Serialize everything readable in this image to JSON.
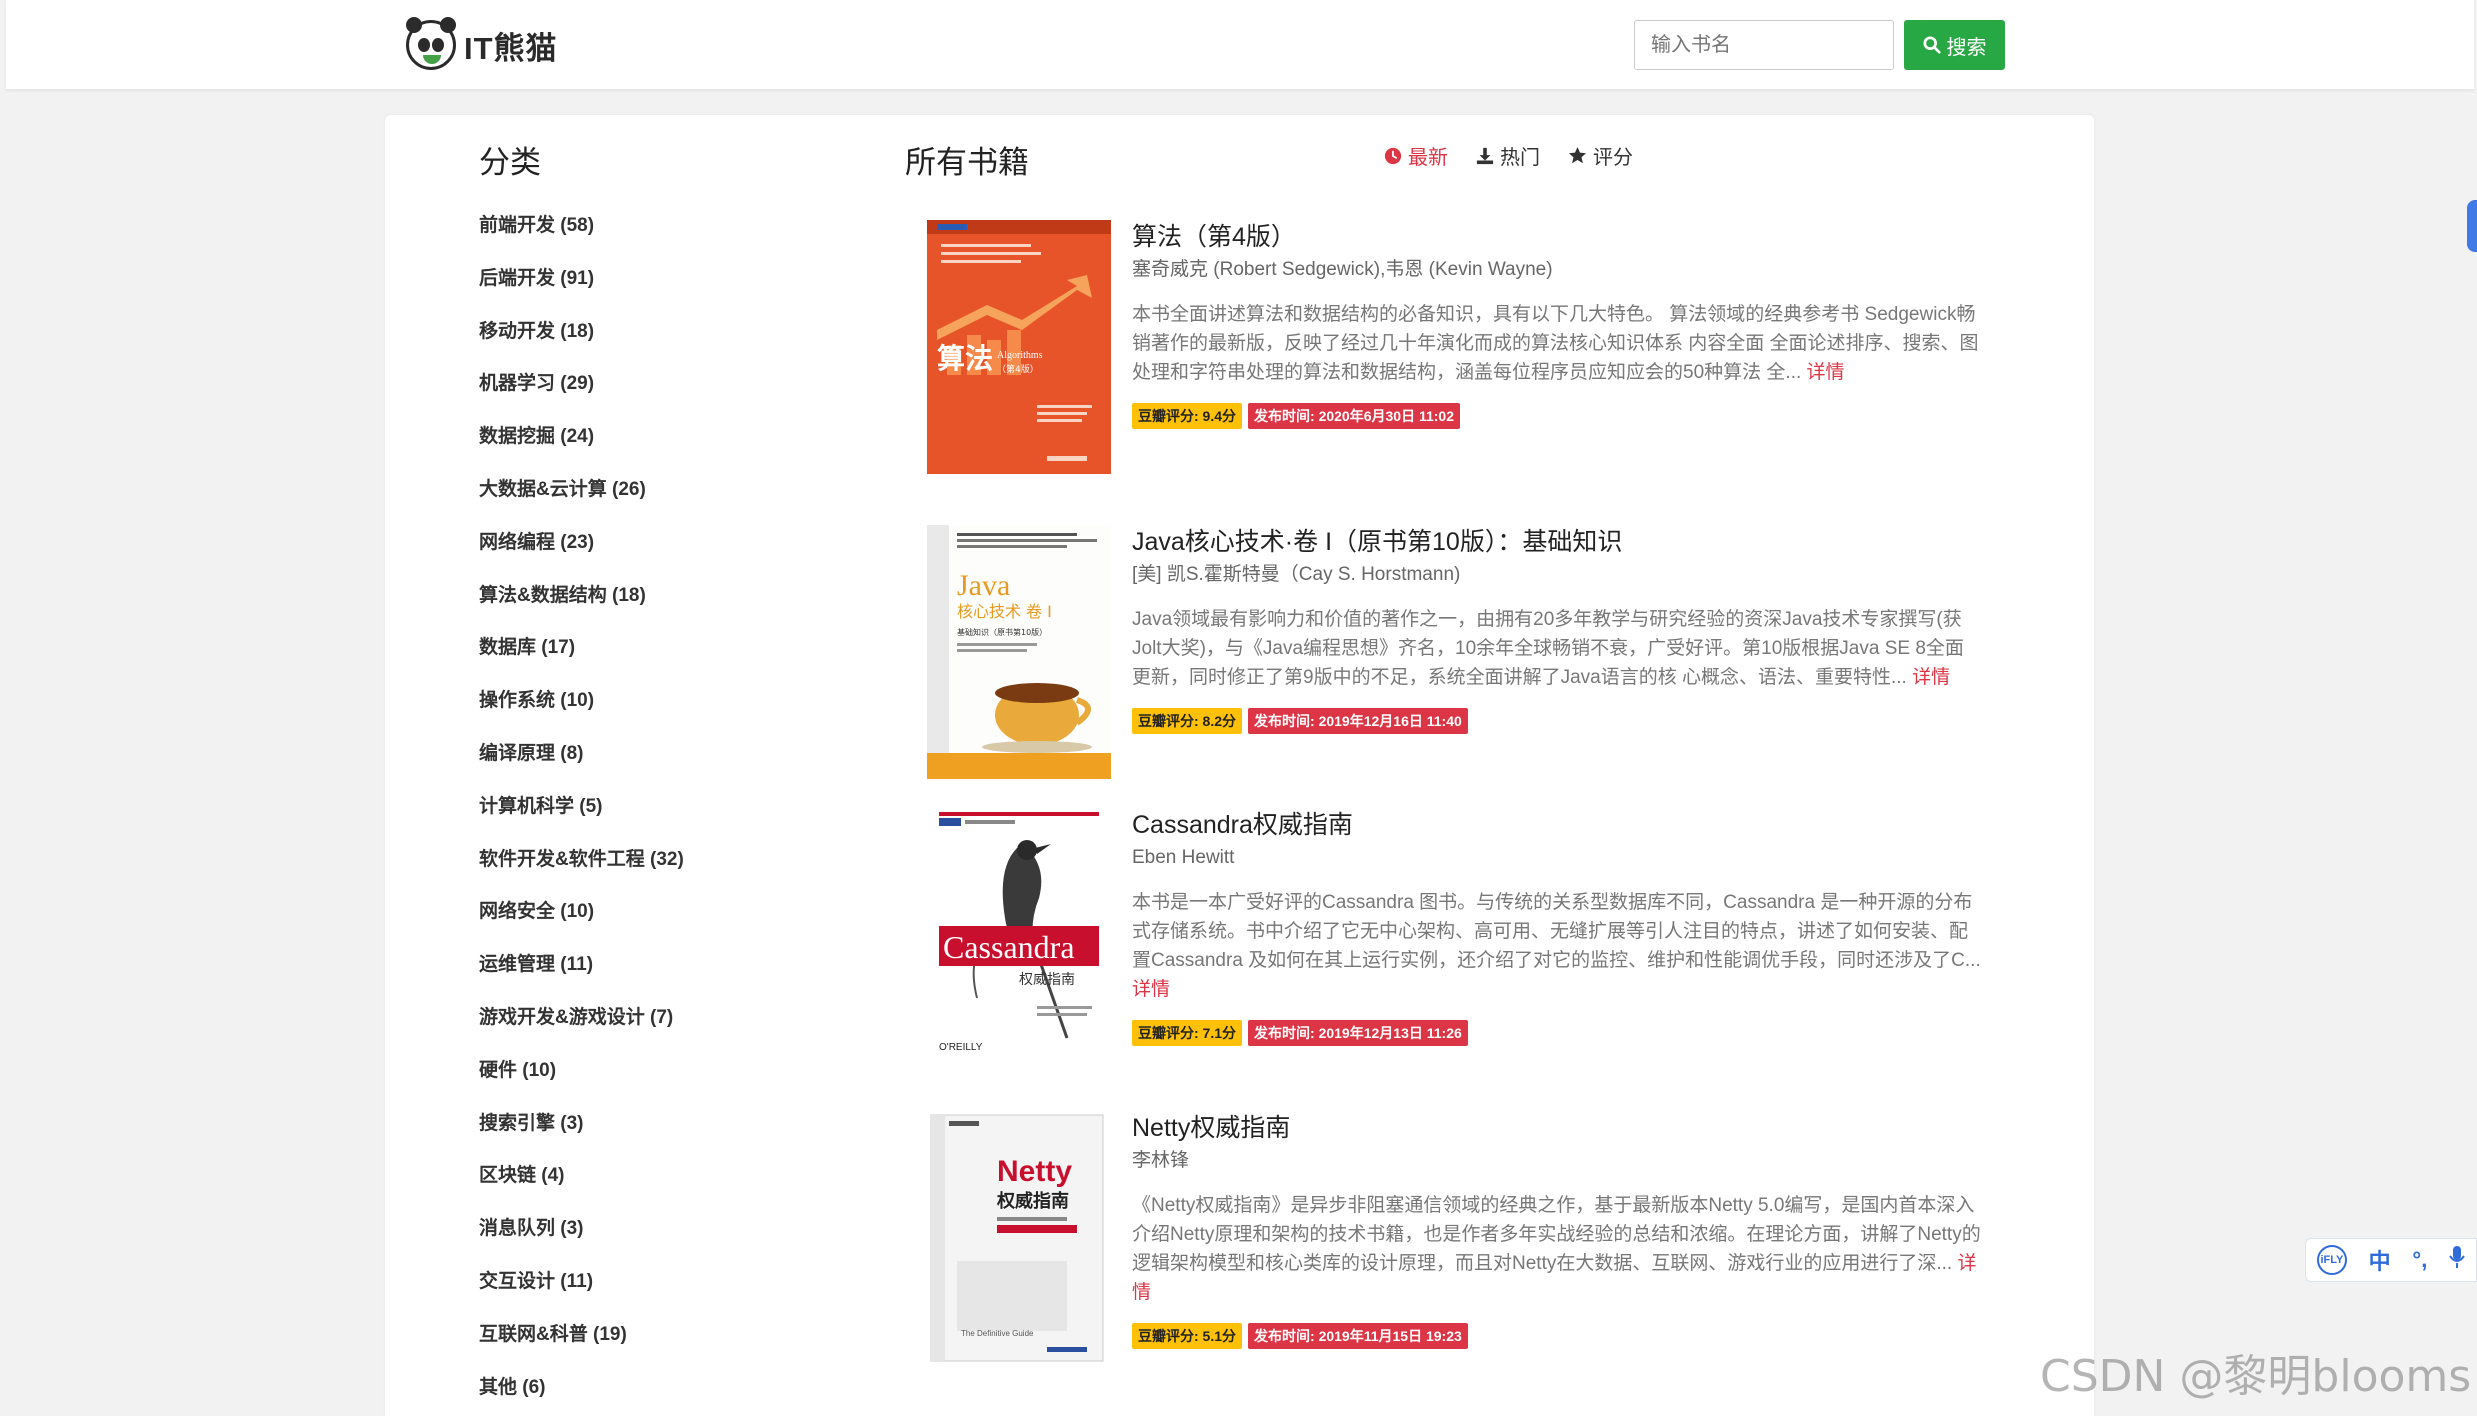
{
  "header": {
    "logo_text": "IT熊猫",
    "search_placeholder": "输入书名",
    "search_button": "搜索"
  },
  "sidebar": {
    "title": "分类",
    "categories": [
      "前端开发 (58)",
      "后端开发 (91)",
      "移动开发 (18)",
      "机器学习 (29)",
      "数据挖掘 (24)",
      "大数据&云计算 (26)",
      "网络编程 (23)",
      "算法&数据结构 (18)",
      "数据库 (17)",
      "操作系统 (10)",
      "编译原理 (8)",
      "计算机科学 (5)",
      "软件开发&软件工程 (32)",
      "网络安全 (10)",
      "运维管理 (11)",
      "游戏开发&游戏设计 (7)",
      "硬件 (10)",
      "搜索引擎 (3)",
      "区块链 (4)",
      "消息队列 (3)",
      "交互设计 (11)",
      "互联网&科普 (19)",
      "其他 (6)"
    ]
  },
  "main": {
    "title": "所有书籍",
    "sort_tabs": [
      {
        "label": "最新",
        "icon": "clock-icon"
      },
      {
        "label": "热门",
        "icon": "download-icon"
      },
      {
        "label": "评分",
        "icon": "star-icon"
      }
    ],
    "detail_label": "详情",
    "books": [
      {
        "title": "算法（第4版）",
        "author": "塞奇威克 (Robert Sedgewick),韦恩 (Kevin Wayne)",
        "description": "本书全面讲述算法和数据结构的必备知识，具有以下几大特色。  算法领域的经典参考书 Sedgewick畅销著作的最新版，反映了经过几十年演化而成的算法核心知识体系  内容全面 全面论述排序、搜索、图处理和字符串处理的算法和数据结构，涵盖每位程序员应知应会的50种算法  全...",
        "rating": "豆瓣评分: 9.4分",
        "date": "发布时间: 2020年6月30日 11:02",
        "cover": {
          "title": "算法",
          "subtitle": "Algorithms",
          "edition": "（第4版）",
          "colors": [
            "#e8542a",
            "#d03f1c"
          ]
        }
      },
      {
        "title": "Java核心技术·卷 I（原书第10版）：基础知识",
        "author": "[美] 凯S.霍斯特曼（Cay S. Horstmann)",
        "description": "Java领域最有影响力和价值的著作之一，由拥有20多年教学与研究经验的资深Java技术专家撰写(获Jolt大奖)，与《Java编程思想》齐名，10余年全球畅销不衰，广受好评。第10版根据Java SE 8全面更新，同时修正了第9版中的不足，系统全面讲解了Java语言的核 心概念、语法、重要特性...",
        "rating": "豆瓣评分: 8.2分",
        "date": "发布时间: 2019年12月16日 11:40",
        "cover": {
          "title": "Java",
          "subtitle": "核心技术 卷 I",
          "edition": "基础知识（原书第10版）",
          "colors": [
            "#ffffff",
            "#f0a020"
          ]
        }
      },
      {
        "title": "Cassandra权威指南",
        "author": "Eben Hewitt",
        "description": "本书是一本广受好评的Cassandra 图书。与传统的关系型数据库不同，Cassandra 是一种开源的分布式存储系统。书中介绍了它无中心架构、高可用、无缝扩展等引人注目的特点，讲述了如何安装、配置Cassandra 及如何在其上运行实例，还介绍了对它的监控、维护和性能调优手段，同时还涉及了C...",
        "rating": "豆瓣评分: 7.1分",
        "date": "发布时间: 2019年12月13日 11:26",
        "cover": {
          "title": "Cassandra",
          "subtitle": "权威指南",
          "edition": "O'REILLY",
          "colors": [
            "#ffffff",
            "#c8102e"
          ]
        }
      },
      {
        "title": "Netty权威指南",
        "author": "李林锋",
        "description": "《Netty权威指南》是异步非阻塞通信领域的经典之作，基于最新版本Netty 5.0编写，是国内首本深入介绍Netty原理和架构的技术书籍，也是作者多年实战经验的总结和浓缩。在理论方面，讲解了Netty的逻辑架构模型和核心类库的设计原理，而且对Netty在大数据、互联网、游戏行业的应用进行了深...",
        "rating": "豆瓣评分: 5.1分",
        "date": "发布时间: 2019年11月15日 19:23",
        "cover": {
          "title": "Netty",
          "subtitle": "权威指南",
          "edition": "The Definitive Guide",
          "colors": [
            "#f4f4f4",
            "#c8102e"
          ]
        }
      }
    ]
  },
  "ime": {
    "brand": "iFLY",
    "lang": "中"
  },
  "watermark": "CSDN @黎明blooms",
  "colors": {
    "accent_green": "#28a745",
    "accent_red": "#dc3545",
    "badge_yellow": "#ffc107"
  }
}
